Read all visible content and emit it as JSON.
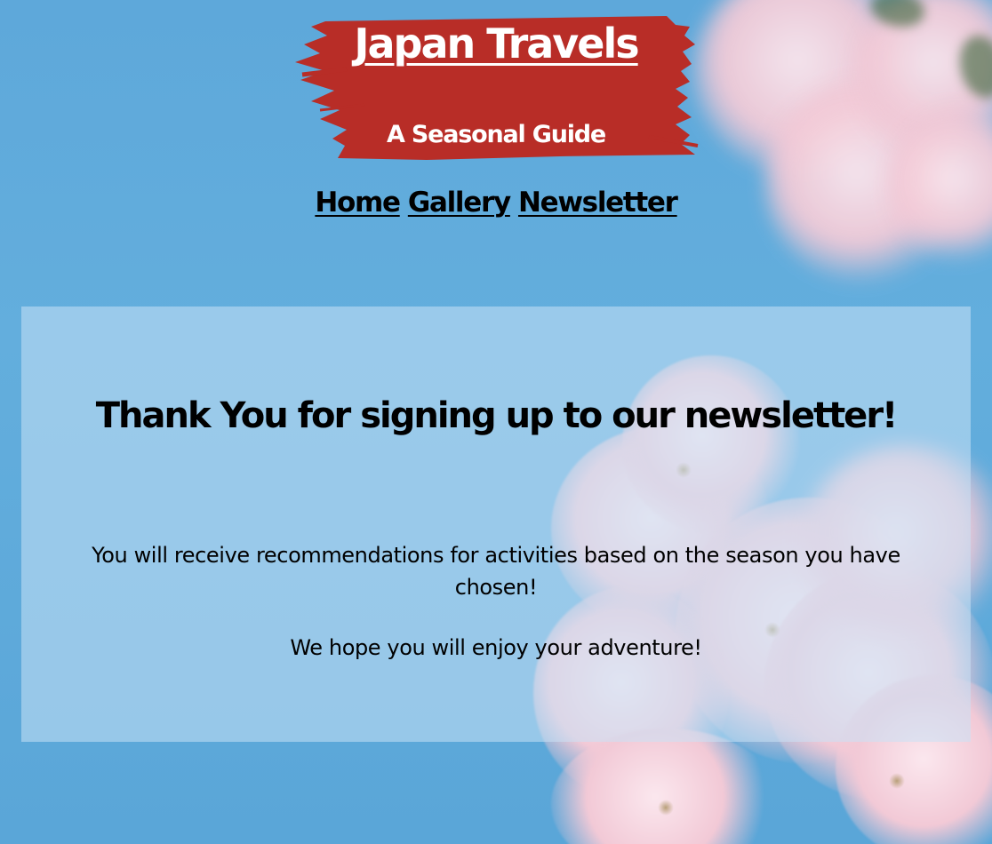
{
  "header": {
    "title": "Japan Travels",
    "subtitle": "A Seasonal Guide"
  },
  "nav": {
    "items": [
      {
        "label": "Home"
      },
      {
        "label": "Gallery"
      },
      {
        "label": "Newsletter"
      }
    ]
  },
  "main": {
    "heading": "Thank You for signing up to our newsletter!",
    "message_1": "You will receive recommendations for activities based on the season you have chosen!",
    "message_2": "We hope you will enjoy your adventure!"
  },
  "colors": {
    "sky": "#5ea8da",
    "brush_red": "#b82d27",
    "panel": "#c8e2f5",
    "blossom": "#f2c9d6"
  },
  "icons": {
    "background": "cherry-blossom-background",
    "title_backdrop": "brush-stroke"
  }
}
